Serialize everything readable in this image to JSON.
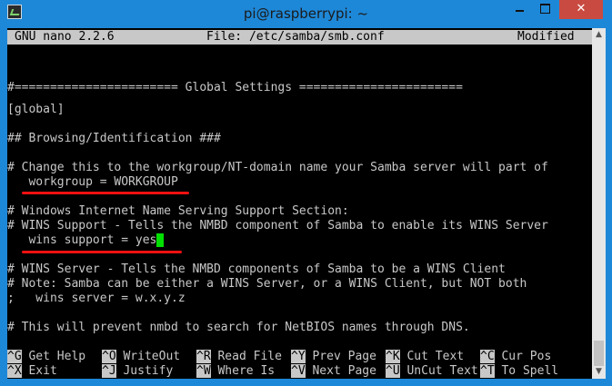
{
  "window": {
    "title": "pi@raspberrypi: ~",
    "close_glyph": "✕"
  },
  "nano": {
    "version": "GNU nano 2.2.6",
    "file": "File: /etc/samba/smb.conf",
    "status": "Modified"
  },
  "editor_lines": [
    "#======================= Global Settings =======================",
    "[global]",
    "## Browsing/Identification ###",
    "# Change this to the workgroup/NT-domain name your Samba server will part of",
    "   workgroup = WORKGROUP",
    "# Windows Internet Name Serving Support Section:",
    "# WINS Support - Tells the NMBD component of Samba to enable its WINS Server",
    "   wins support = yes",
    "# WINS Server - Tells the NMBD components of Samba to be a WINS Client",
    "# Note: Samba can be either a WINS Server, or a WINS Client, but NOT both",
    ";   wins server = w.x.y.z",
    "# This will prevent nmbd to search for NetBIOS names through DNS."
  ],
  "shortcuts": [
    {
      "key": "^G",
      "label": "Get Help"
    },
    {
      "key": "^O",
      "label": "WriteOut"
    },
    {
      "key": "^R",
      "label": "Read File"
    },
    {
      "key": "^Y",
      "label": "Prev Page"
    },
    {
      "key": "^K",
      "label": "Cut Text"
    },
    {
      "key": "^C",
      "label": "Cur Pos"
    },
    {
      "key": "^X",
      "label": "Exit"
    },
    {
      "key": "^J",
      "label": "Justify"
    },
    {
      "key": "^W",
      "label": "Where Is"
    },
    {
      "key": "^V",
      "label": "Next Page"
    },
    {
      "key": "^U",
      "label": "UnCut Text"
    },
    {
      "key": "^T",
      "label": "To Spell"
    }
  ],
  "colors": {
    "chrome": "#1e88d8",
    "terminal_bg": "#000000",
    "text": "#c8c8c8",
    "cursor": "#00e000",
    "annotation": "#ee1111",
    "close_button": "#c94a40"
  }
}
